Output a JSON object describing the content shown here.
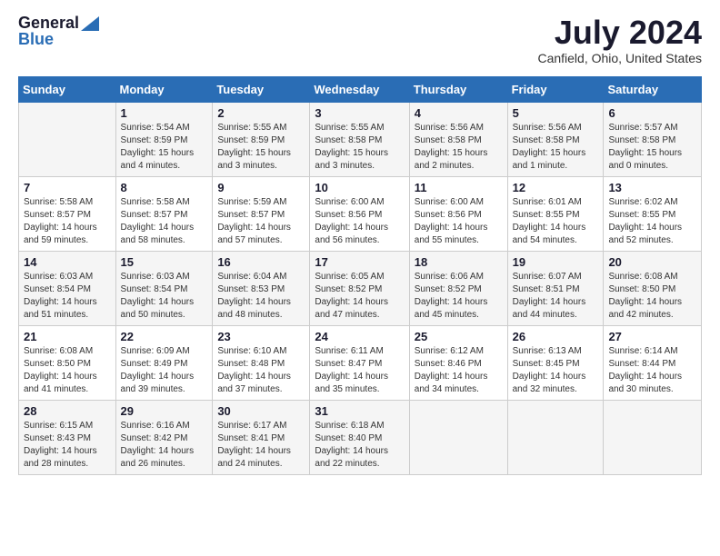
{
  "header": {
    "logo_general": "General",
    "logo_blue": "Blue",
    "month_year": "July 2024",
    "location": "Canfield, Ohio, United States"
  },
  "days_of_week": [
    "Sunday",
    "Monday",
    "Tuesday",
    "Wednesday",
    "Thursday",
    "Friday",
    "Saturday"
  ],
  "weeks": [
    [
      {
        "day": "",
        "info": ""
      },
      {
        "day": "1",
        "info": "Sunrise: 5:54 AM\nSunset: 8:59 PM\nDaylight: 15 hours\nand 4 minutes."
      },
      {
        "day": "2",
        "info": "Sunrise: 5:55 AM\nSunset: 8:59 PM\nDaylight: 15 hours\nand 3 minutes."
      },
      {
        "day": "3",
        "info": "Sunrise: 5:55 AM\nSunset: 8:58 PM\nDaylight: 15 hours\nand 3 minutes."
      },
      {
        "day": "4",
        "info": "Sunrise: 5:56 AM\nSunset: 8:58 PM\nDaylight: 15 hours\nand 2 minutes."
      },
      {
        "day": "5",
        "info": "Sunrise: 5:56 AM\nSunset: 8:58 PM\nDaylight: 15 hours\nand 1 minute."
      },
      {
        "day": "6",
        "info": "Sunrise: 5:57 AM\nSunset: 8:58 PM\nDaylight: 15 hours\nand 0 minutes."
      }
    ],
    [
      {
        "day": "7",
        "info": "Sunrise: 5:58 AM\nSunset: 8:57 PM\nDaylight: 14 hours\nand 59 minutes."
      },
      {
        "day": "8",
        "info": "Sunrise: 5:58 AM\nSunset: 8:57 PM\nDaylight: 14 hours\nand 58 minutes."
      },
      {
        "day": "9",
        "info": "Sunrise: 5:59 AM\nSunset: 8:57 PM\nDaylight: 14 hours\nand 57 minutes."
      },
      {
        "day": "10",
        "info": "Sunrise: 6:00 AM\nSunset: 8:56 PM\nDaylight: 14 hours\nand 56 minutes."
      },
      {
        "day": "11",
        "info": "Sunrise: 6:00 AM\nSunset: 8:56 PM\nDaylight: 14 hours\nand 55 minutes."
      },
      {
        "day": "12",
        "info": "Sunrise: 6:01 AM\nSunset: 8:55 PM\nDaylight: 14 hours\nand 54 minutes."
      },
      {
        "day": "13",
        "info": "Sunrise: 6:02 AM\nSunset: 8:55 PM\nDaylight: 14 hours\nand 52 minutes."
      }
    ],
    [
      {
        "day": "14",
        "info": "Sunrise: 6:03 AM\nSunset: 8:54 PM\nDaylight: 14 hours\nand 51 minutes."
      },
      {
        "day": "15",
        "info": "Sunrise: 6:03 AM\nSunset: 8:54 PM\nDaylight: 14 hours\nand 50 minutes."
      },
      {
        "day": "16",
        "info": "Sunrise: 6:04 AM\nSunset: 8:53 PM\nDaylight: 14 hours\nand 48 minutes."
      },
      {
        "day": "17",
        "info": "Sunrise: 6:05 AM\nSunset: 8:52 PM\nDaylight: 14 hours\nand 47 minutes."
      },
      {
        "day": "18",
        "info": "Sunrise: 6:06 AM\nSunset: 8:52 PM\nDaylight: 14 hours\nand 45 minutes."
      },
      {
        "day": "19",
        "info": "Sunrise: 6:07 AM\nSunset: 8:51 PM\nDaylight: 14 hours\nand 44 minutes."
      },
      {
        "day": "20",
        "info": "Sunrise: 6:08 AM\nSunset: 8:50 PM\nDaylight: 14 hours\nand 42 minutes."
      }
    ],
    [
      {
        "day": "21",
        "info": "Sunrise: 6:08 AM\nSunset: 8:50 PM\nDaylight: 14 hours\nand 41 minutes."
      },
      {
        "day": "22",
        "info": "Sunrise: 6:09 AM\nSunset: 8:49 PM\nDaylight: 14 hours\nand 39 minutes."
      },
      {
        "day": "23",
        "info": "Sunrise: 6:10 AM\nSunset: 8:48 PM\nDaylight: 14 hours\nand 37 minutes."
      },
      {
        "day": "24",
        "info": "Sunrise: 6:11 AM\nSunset: 8:47 PM\nDaylight: 14 hours\nand 35 minutes."
      },
      {
        "day": "25",
        "info": "Sunrise: 6:12 AM\nSunset: 8:46 PM\nDaylight: 14 hours\nand 34 minutes."
      },
      {
        "day": "26",
        "info": "Sunrise: 6:13 AM\nSunset: 8:45 PM\nDaylight: 14 hours\nand 32 minutes."
      },
      {
        "day": "27",
        "info": "Sunrise: 6:14 AM\nSunset: 8:44 PM\nDaylight: 14 hours\nand 30 minutes."
      }
    ],
    [
      {
        "day": "28",
        "info": "Sunrise: 6:15 AM\nSunset: 8:43 PM\nDaylight: 14 hours\nand 28 minutes."
      },
      {
        "day": "29",
        "info": "Sunrise: 6:16 AM\nSunset: 8:42 PM\nDaylight: 14 hours\nand 26 minutes."
      },
      {
        "day": "30",
        "info": "Sunrise: 6:17 AM\nSunset: 8:41 PM\nDaylight: 14 hours\nand 24 minutes."
      },
      {
        "day": "31",
        "info": "Sunrise: 6:18 AM\nSunset: 8:40 PM\nDaylight: 14 hours\nand 22 minutes."
      },
      {
        "day": "",
        "info": ""
      },
      {
        "day": "",
        "info": ""
      },
      {
        "day": "",
        "info": ""
      }
    ]
  ]
}
